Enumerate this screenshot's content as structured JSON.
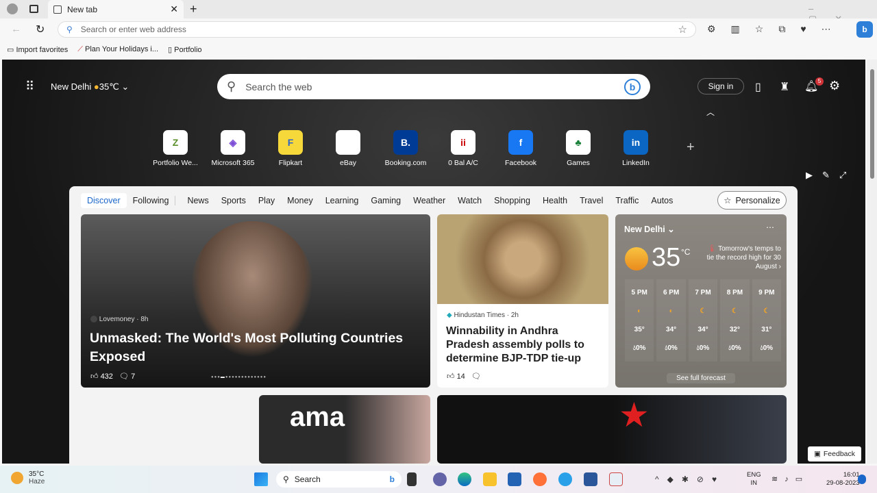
{
  "browser": {
    "tab_title": "New tab",
    "address_placeholder": "Search or enter web address",
    "favorites": [
      "Import favorites",
      "Plan Your Holidays i...",
      "Portfolio"
    ]
  },
  "header": {
    "location": "New Delhi",
    "temp": "35℃",
    "search_placeholder": "Search the web",
    "sign_in": "Sign in",
    "notif_count": "5"
  },
  "shortcuts": [
    "Portfolio We...",
    "Microsoft 365",
    "Flipkart",
    "eBay",
    "Booking.com",
    "0 Bal A/C",
    "Facebook",
    "Games",
    "LinkedIn"
  ],
  "shortcut_glyphs": [
    "Z",
    "◈",
    "F",
    "🛍",
    "B.",
    "ii",
    "f",
    "♣",
    "in"
  ],
  "nav": {
    "tabs": [
      "Discover",
      "Following",
      "News",
      "Sports",
      "Play",
      "Money",
      "Learning",
      "Gaming",
      "Weather",
      "Watch",
      "Shopping",
      "Health",
      "Travel",
      "Traffic",
      "Autos"
    ],
    "personalize": "Personalize"
  },
  "hero": {
    "source": "Lovemoney · 8h",
    "title": "Unmasked: The World's Most Polluting Countries Exposed",
    "likes": "432",
    "comments": "7"
  },
  "news": {
    "source": "Hindustan Times · 2h",
    "title": "Winnability in Andhra Pradesh assembly polls to determine BJP-TDP tie-up",
    "likes": "14"
  },
  "weather": {
    "location": "New Delhi",
    "temp": "35",
    "unit": "°C",
    "alert": "Tomorrow's temps to tie the record high for 30 August",
    "hours": [
      {
        "t": "5 PM",
        "temp": "35°",
        "rain": "0%"
      },
      {
        "t": "6 PM",
        "temp": "34°",
        "rain": "0%"
      },
      {
        "t": "7 PM",
        "temp": "34°",
        "rain": "0%"
      },
      {
        "t": "8 PM",
        "temp": "32°",
        "rain": "0%"
      },
      {
        "t": "9 PM",
        "temp": "31°",
        "rain": "0%"
      }
    ],
    "forecast_link": "See full forecast"
  },
  "feedback": "Feedback",
  "taskbar": {
    "temp": "35°C",
    "cond": "Haze",
    "search": "Search",
    "lang1": "ENG",
    "lang2": "IN",
    "time": "16:01",
    "date": "29-08-2023"
  }
}
